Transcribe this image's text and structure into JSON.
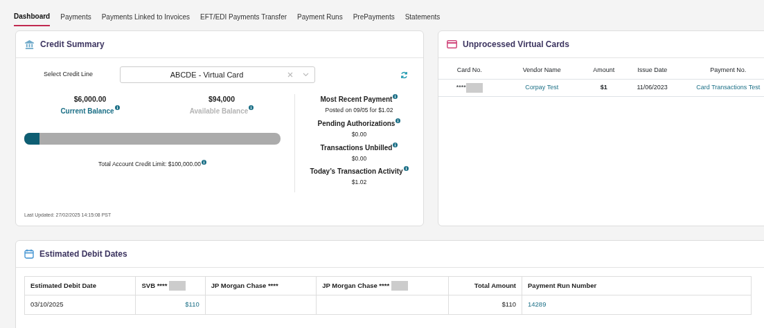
{
  "tabs": [
    {
      "label": "Dashboard",
      "selected": true
    },
    {
      "label": "Payments",
      "selected": false
    },
    {
      "label": "Payments Linked to Invoices",
      "selected": false
    },
    {
      "label": "EFT/EDI Payments Transfer",
      "selected": false
    },
    {
      "label": "Payment Runs",
      "selected": false
    },
    {
      "label": "PrePayments",
      "selected": false
    },
    {
      "label": "Statements",
      "selected": false
    }
  ],
  "credit_summary": {
    "title": "Credit Summary",
    "select_label": "Select Credit Line",
    "select_value": "ABCDE - Virtual Card",
    "current_balance": {
      "amount": "$6,000.00",
      "label": "Current Balance"
    },
    "available_balance": {
      "amount": "$94,000",
      "label": "Available Balance"
    },
    "level": 0.06,
    "credit_limit": "Total Account Credit Limit: $100,000.00",
    "stats": [
      {
        "label": "Most Recent Payment",
        "value": "Posted on 09/05 for $1.02"
      },
      {
        "label": "Pending Authorizations",
        "value": "$0.00"
      },
      {
        "label": "Transactions Unbilled",
        "value": "$0.00"
      },
      {
        "label": "Today’s Transaction Activity",
        "value": "$1.02"
      }
    ],
    "last_updated": "Last Updated: 27/02/2025 14:15:08 PST"
  },
  "virtual_cards": {
    "title": "Unprocessed Virtual Cards",
    "columns": [
      "Card No.",
      "Vendor Name",
      "Amount",
      "Issue Date",
      "Payment No."
    ],
    "rows": [
      {
        "card_no": "****",
        "vendor": "Corpay Test",
        "amount": "$1",
        "issue_date": "11/06/2023",
        "payment_no": "Card Transactions Test"
      }
    ]
  },
  "debit_dates": {
    "title": "Estimated Debit Dates",
    "columns": [
      "Estimated Debit Date",
      "SVB ****",
      "JP Morgan Chase ****",
      "JP Morgan Chase ****",
      "Total Amount",
      "Payment Run Number"
    ],
    "rows": [
      [
        "03/10/2025",
        "$110",
        "",
        "",
        "$110",
        "14289"
      ]
    ]
  }
}
